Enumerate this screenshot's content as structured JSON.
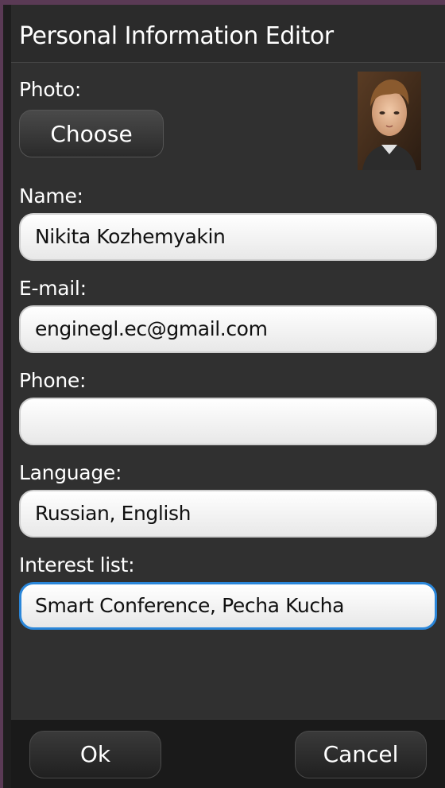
{
  "window": {
    "title": "Personal Information Editor"
  },
  "photo": {
    "label": "Photo:",
    "choose_label": "Choose",
    "image": "portrait-photo"
  },
  "form": {
    "name": {
      "label": "Name:",
      "value": "Nikita Kozhemyakin"
    },
    "email": {
      "label": "E-mail:",
      "value": "enginegl.ec@gmail.com"
    },
    "phone": {
      "label": "Phone:",
      "value": ""
    },
    "language": {
      "label": "Language:",
      "value": "Russian, English"
    },
    "interests": {
      "label": "Interest list:",
      "value": "Smart Conference, Pecha Kucha"
    }
  },
  "buttons": {
    "ok_label": "Ok",
    "cancel_label": "Cancel"
  },
  "colors": {
    "focus_border": "#2a86d9",
    "background": "#303030",
    "text": "#ffffff"
  }
}
